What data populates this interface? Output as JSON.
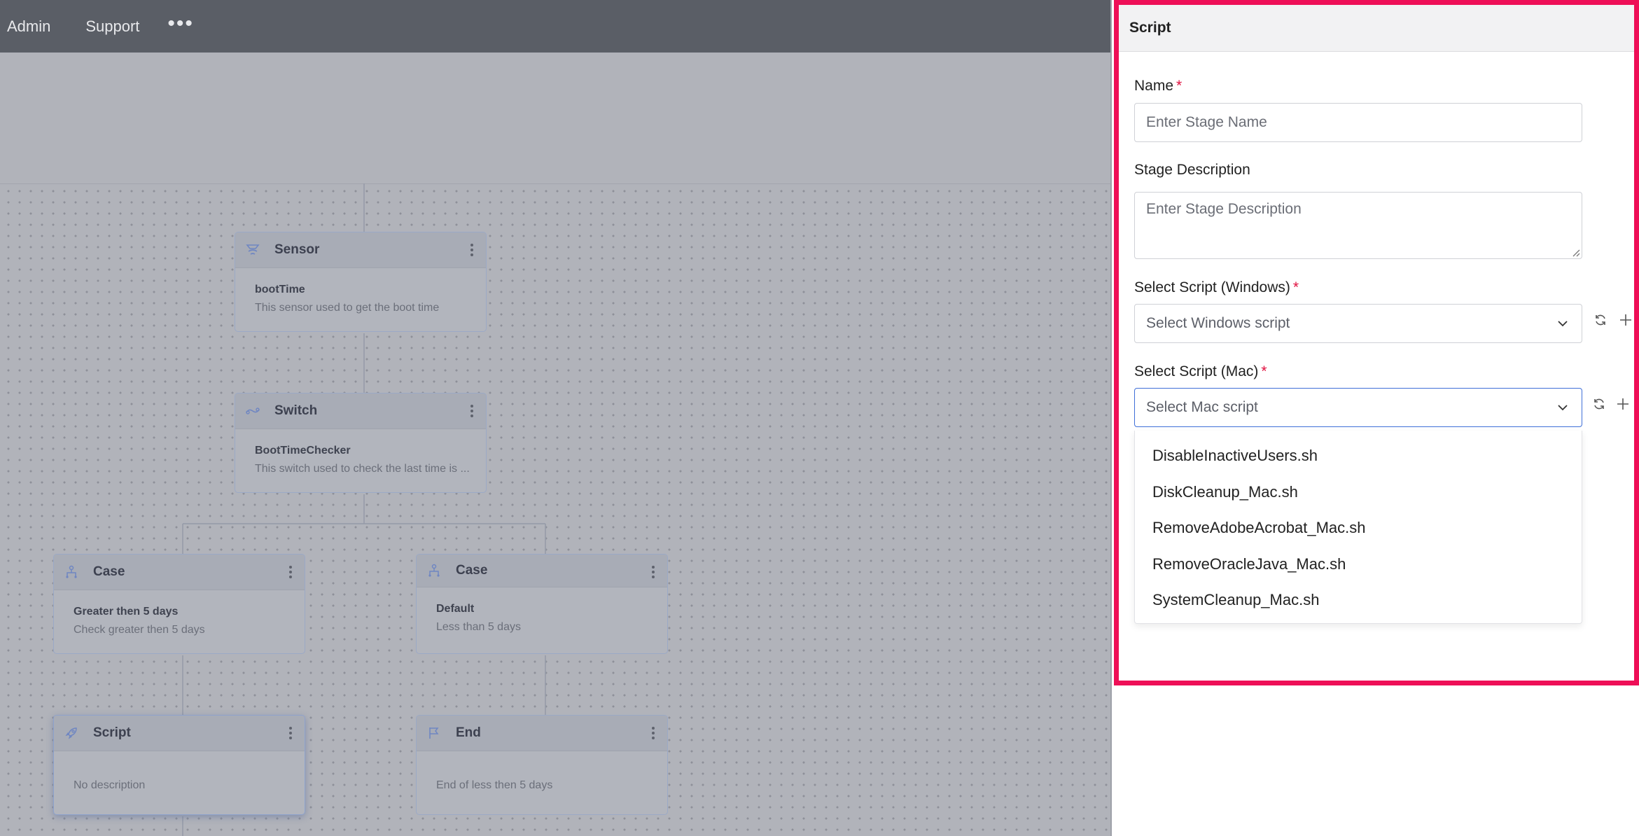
{
  "topbar": {
    "links": [
      "Admin",
      "Support"
    ],
    "more_icon": "more-horizontal-icon"
  },
  "workflow": {
    "nodes": [
      {
        "key": "sensor",
        "title": "Sensor",
        "subtitle": "bootTime",
        "description": "This sensor used to get the boot time",
        "icon": "sensor-icon"
      },
      {
        "key": "switch",
        "title": "Switch",
        "subtitle": "BootTimeChecker",
        "description": "This switch used to check the last time is ...",
        "icon": "switch-icon"
      },
      {
        "key": "case1",
        "title": "Case",
        "subtitle": "Greater then 5 days",
        "description": "Check greater then 5 days",
        "icon": "case-icon"
      },
      {
        "key": "case2",
        "title": "Case",
        "subtitle": "Default",
        "description": "Less than 5 days",
        "icon": "case-icon"
      },
      {
        "key": "script",
        "title": "Script",
        "subtitle": "",
        "description": "No description",
        "icon": "rocket-icon"
      },
      {
        "key": "end",
        "title": "End",
        "subtitle": "",
        "description": "End of less then 5 days",
        "icon": "flag-icon"
      }
    ]
  },
  "panel": {
    "title": "Script",
    "highlight_color": "#ee0f57",
    "name": {
      "label": "Name",
      "required": "*",
      "placeholder": "Enter Stage Name"
    },
    "description": {
      "label": "Stage Description",
      "placeholder": "Enter Stage Description"
    },
    "windows": {
      "label": "Select Script (Windows)",
      "required": "*",
      "placeholder": "Select Windows script"
    },
    "mac": {
      "label": "Select Script (Mac)",
      "required": "*",
      "placeholder": "Select Mac script",
      "options": [
        "DisableInactiveUsers.sh",
        "DiskCleanup_Mac.sh",
        "RemoveAdobeAcrobat_Mac.sh",
        "RemoveOracleJava_Mac.sh",
        "SystemCleanup_Mac.sh"
      ]
    }
  }
}
